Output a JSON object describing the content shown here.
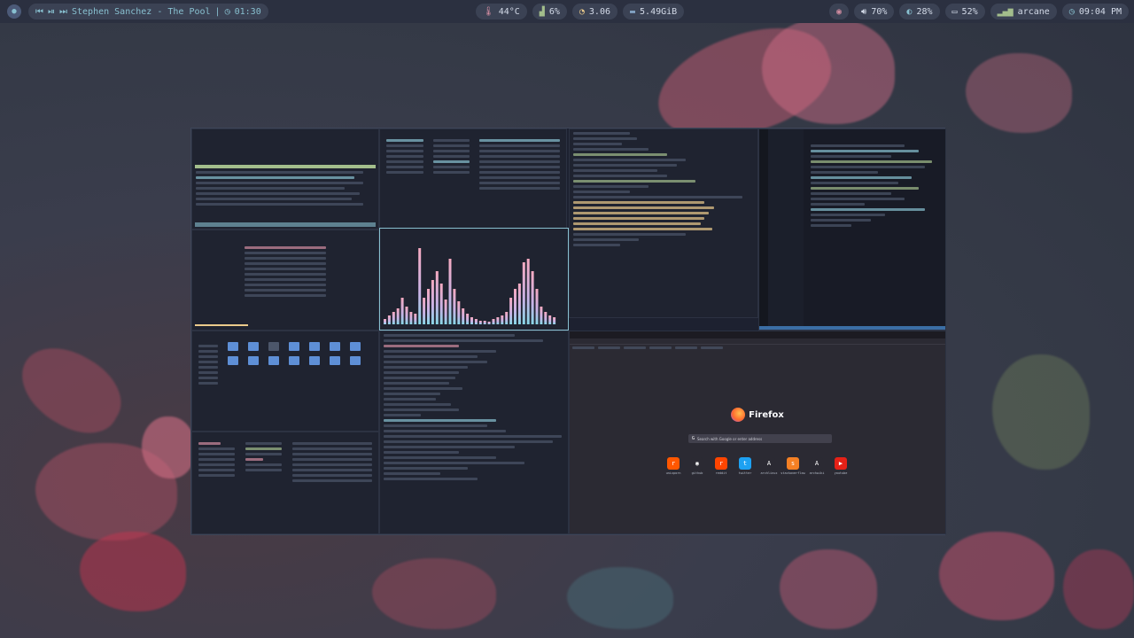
{
  "topbar": {
    "media": {
      "track": "Stephen Sanchez - The Pool",
      "position": "01:30"
    },
    "stats": {
      "temperature": "44°C",
      "cpu": "6%",
      "load": "3.06",
      "disk": "5.49GiB"
    },
    "status": {
      "volume": "70%",
      "brightness": "28%",
      "memory": "52%",
      "network": "arcane",
      "clock": "09:04 PM"
    }
  },
  "firefox": {
    "brand": "Firefox",
    "search_placeholder": "Search with Google or enter address",
    "shortcuts": [
      {
        "label": "unixporn",
        "color": "#ff5700",
        "glyph": "r"
      },
      {
        "label": "github",
        "color": "#2b2a33",
        "glyph": "◉"
      },
      {
        "label": "reddit",
        "color": "#ff4500",
        "glyph": "r"
      },
      {
        "label": "twitter",
        "color": "#1da1f2",
        "glyph": "t"
      },
      {
        "label": "archlinux",
        "color": "#2b2a33",
        "glyph": "A"
      },
      {
        "label": "stackoverflow",
        "color": "#f48024",
        "glyph": "s"
      },
      {
        "label": "archwiki",
        "color": "#2b2a33",
        "glyph": "A"
      },
      {
        "label": "youtube",
        "color": "#e62117",
        "glyph": "▶"
      }
    ]
  },
  "colors": {
    "accent": "#88c0d0",
    "bar_bg": "#2b3040",
    "pill_bg": "#3b4254"
  }
}
